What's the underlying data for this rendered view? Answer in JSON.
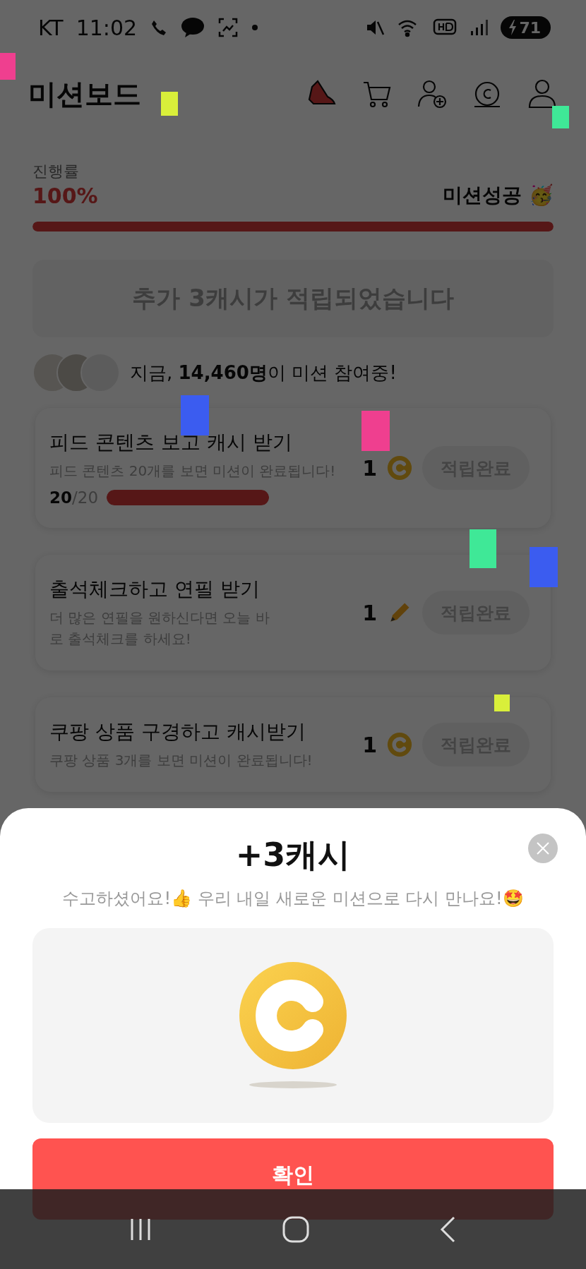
{
  "status_bar": {
    "carrier": "KT",
    "time": "11:02",
    "battery": "71"
  },
  "header": {
    "title": "미션보드"
  },
  "progress": {
    "label": "진행률",
    "value": "100%",
    "status": "미션성공 🥳",
    "level": 1
  },
  "banner": {
    "text": "추가 3캐시가 적립되었습니다"
  },
  "participants": {
    "text": "지금, **14,460명**이 미션 참여중!"
  },
  "missions": [
    {
      "title": "피드 콘텐츠 보고 캐시 받기",
      "description": "피드 콘텐츠 20개를 보면 미션이 완료됩니다!",
      "progress_done": "20",
      "progress_total": "/20",
      "level": 1,
      "reward": "1",
      "kind": "coin",
      "button": "적립완료"
    },
    {
      "title": "출석체크하고 연필 받기",
      "description": "더 많은 연필을 원하신다면 오늘 바로 출석체크를 하세요!",
      "reward": "1",
      "kind": "pencil",
      "button": "적립완료"
    },
    {
      "title": "쿠팡 상품 구경하고 캐시받기",
      "description": "쿠팡 상품 3개를 보면 미션이 완료됩니다!",
      "reward": "1",
      "kind": "coin",
      "button": "적립완료"
    }
  ],
  "sheet": {
    "title": "+3캐시",
    "subtitle": "수고하셨어요!👍 우리 내일 새로운 미션으로 다시 만나요!🤩",
    "confirm": "확인"
  }
}
